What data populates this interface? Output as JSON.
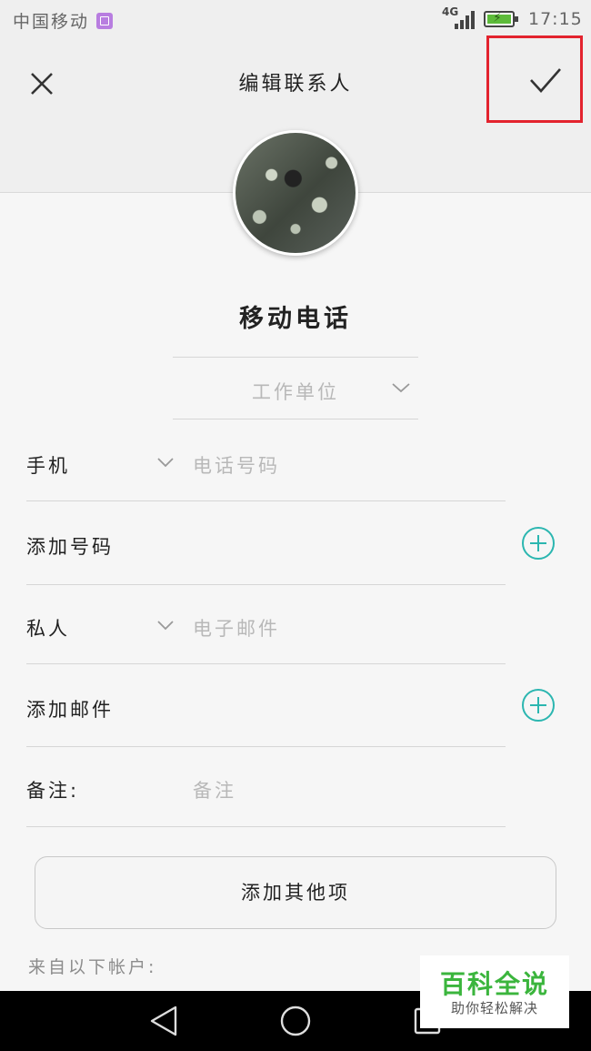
{
  "status_bar": {
    "carrier": "中国移动",
    "network_type": "4G",
    "time": "17:15",
    "icons": [
      "image-notification-icon",
      "signal-icon",
      "battery-charging-icon"
    ]
  },
  "header": {
    "title": "编辑联系人",
    "close_icon": "close-icon",
    "confirm_icon": "checkmark-icon"
  },
  "contact": {
    "name_placeholder": "移动电话",
    "company_placeholder": "工作单位"
  },
  "fields": {
    "phone": {
      "label": "手机",
      "placeholder": "电话号码"
    },
    "add_number": {
      "label": "添加号码"
    },
    "email": {
      "label": "私人",
      "placeholder": "电子邮件"
    },
    "add_email": {
      "label": "添加邮件"
    },
    "notes": {
      "label": "备注:",
      "placeholder": "备注"
    }
  },
  "add_other_label": "添加其他项",
  "accounts_label": "来自以下帐户:",
  "watermark": {
    "title": "百科全说",
    "subtitle": "助你轻松解决"
  },
  "colors": {
    "accent_teal": "#2bb6b0",
    "highlight_red": "#e3232e",
    "watermark_green": "#3bb53d"
  }
}
